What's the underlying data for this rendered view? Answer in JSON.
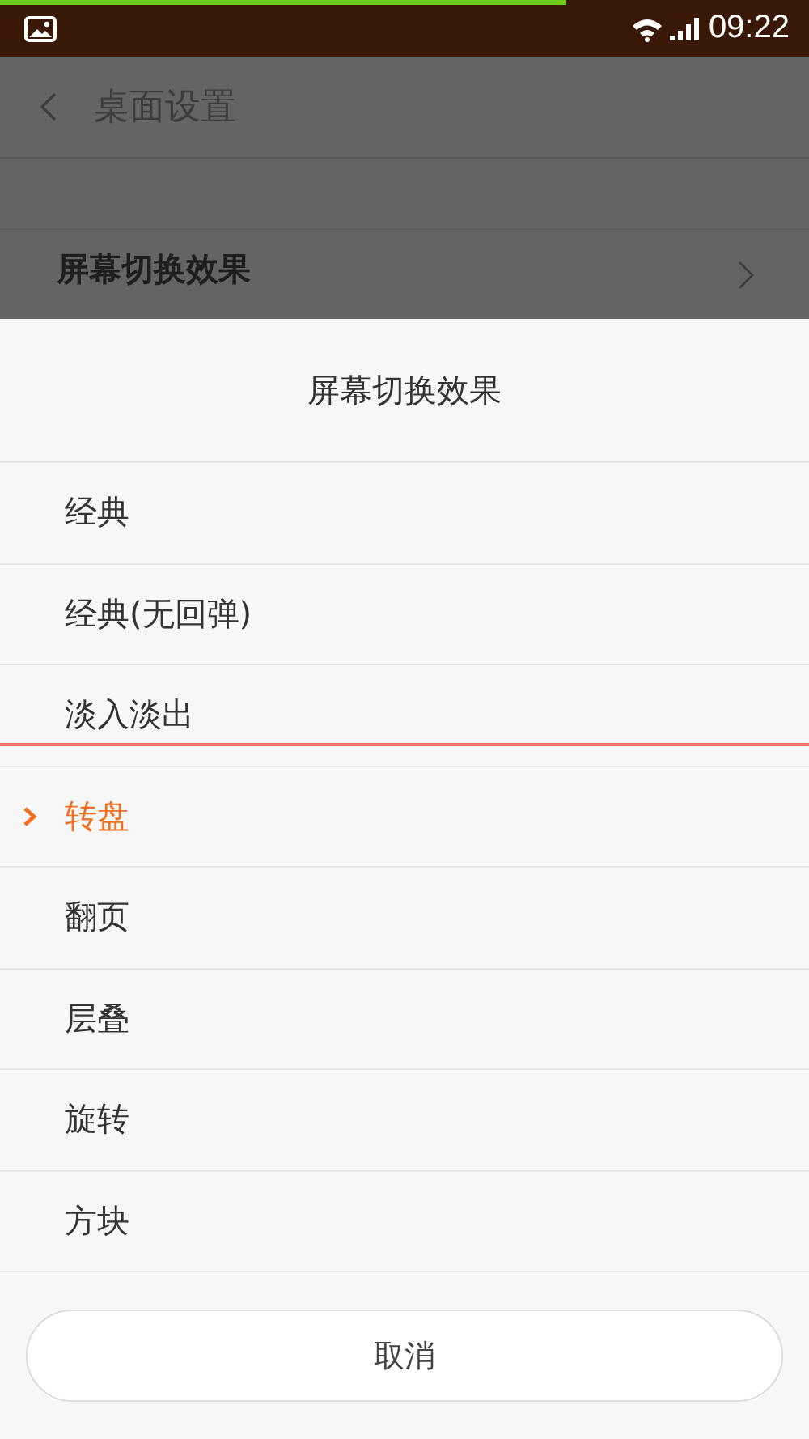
{
  "status_bar": {
    "time": "09:22",
    "progress": {
      "level": 0.7
    }
  },
  "header": {
    "title": "桌面设置"
  },
  "setting_row": {
    "label": "屏幕切换效果"
  },
  "sheet": {
    "title": "屏幕切换效果",
    "options": [
      {
        "label": "经典",
        "selected": false
      },
      {
        "label": "经典(无回弹)",
        "selected": false
      },
      {
        "label": "淡入淡出",
        "selected": false
      },
      {
        "label": "转盘",
        "selected": true
      },
      {
        "label": "翻页",
        "selected": false
      },
      {
        "label": "层叠",
        "selected": false
      },
      {
        "label": "旋转",
        "selected": false
      },
      {
        "label": "方块",
        "selected": false
      }
    ],
    "cancel": "取消"
  }
}
